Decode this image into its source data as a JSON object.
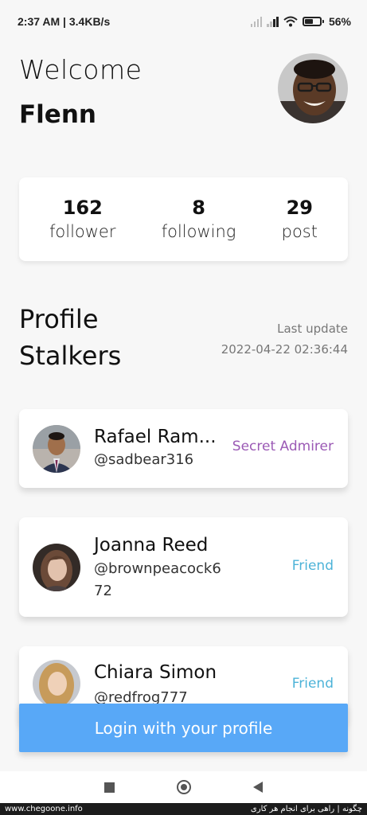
{
  "status_bar": {
    "time": "2:37 AM",
    "network_speed": "3.4KB/s",
    "battery_percent": "56",
    "battery_level": 0.56,
    "icons": [
      "signal-icon",
      "signal-icon",
      "wifi-icon",
      "battery-icon"
    ]
  },
  "header": {
    "welcome": "Welcome",
    "username": "Flenn"
  },
  "stats": [
    {
      "value": "162",
      "label": "follower"
    },
    {
      "value": "8",
      "label": "following"
    },
    {
      "value": "29",
      "label": "post"
    }
  ],
  "stalkers": {
    "title_line1": "Profile",
    "title_line2": "Stalkers",
    "last_update_label": "Last update",
    "last_update_value": "2022-04-22 02:36:44",
    "items": [
      {
        "name": "Rafael Ram...",
        "handle": "@sadbear316",
        "relation": "Secret Admirer"
      },
      {
        "name": "Joanna Reed",
        "handle": "@brownpeacock672",
        "relation": "Friend"
      },
      {
        "name": "Chiara Simon",
        "handle": "@redfrog777",
        "relation": "Friend"
      }
    ]
  },
  "login_button": "Login with your profile",
  "watermark": {
    "left": "www.chegoone.info",
    "right": "چگونه | راهی برای انجام هر کاری"
  },
  "colors": {
    "accent": "#58a8f7",
    "admirer": "#9b5ab5",
    "friend": "#4db3d8",
    "background": "#f7f7f7"
  }
}
